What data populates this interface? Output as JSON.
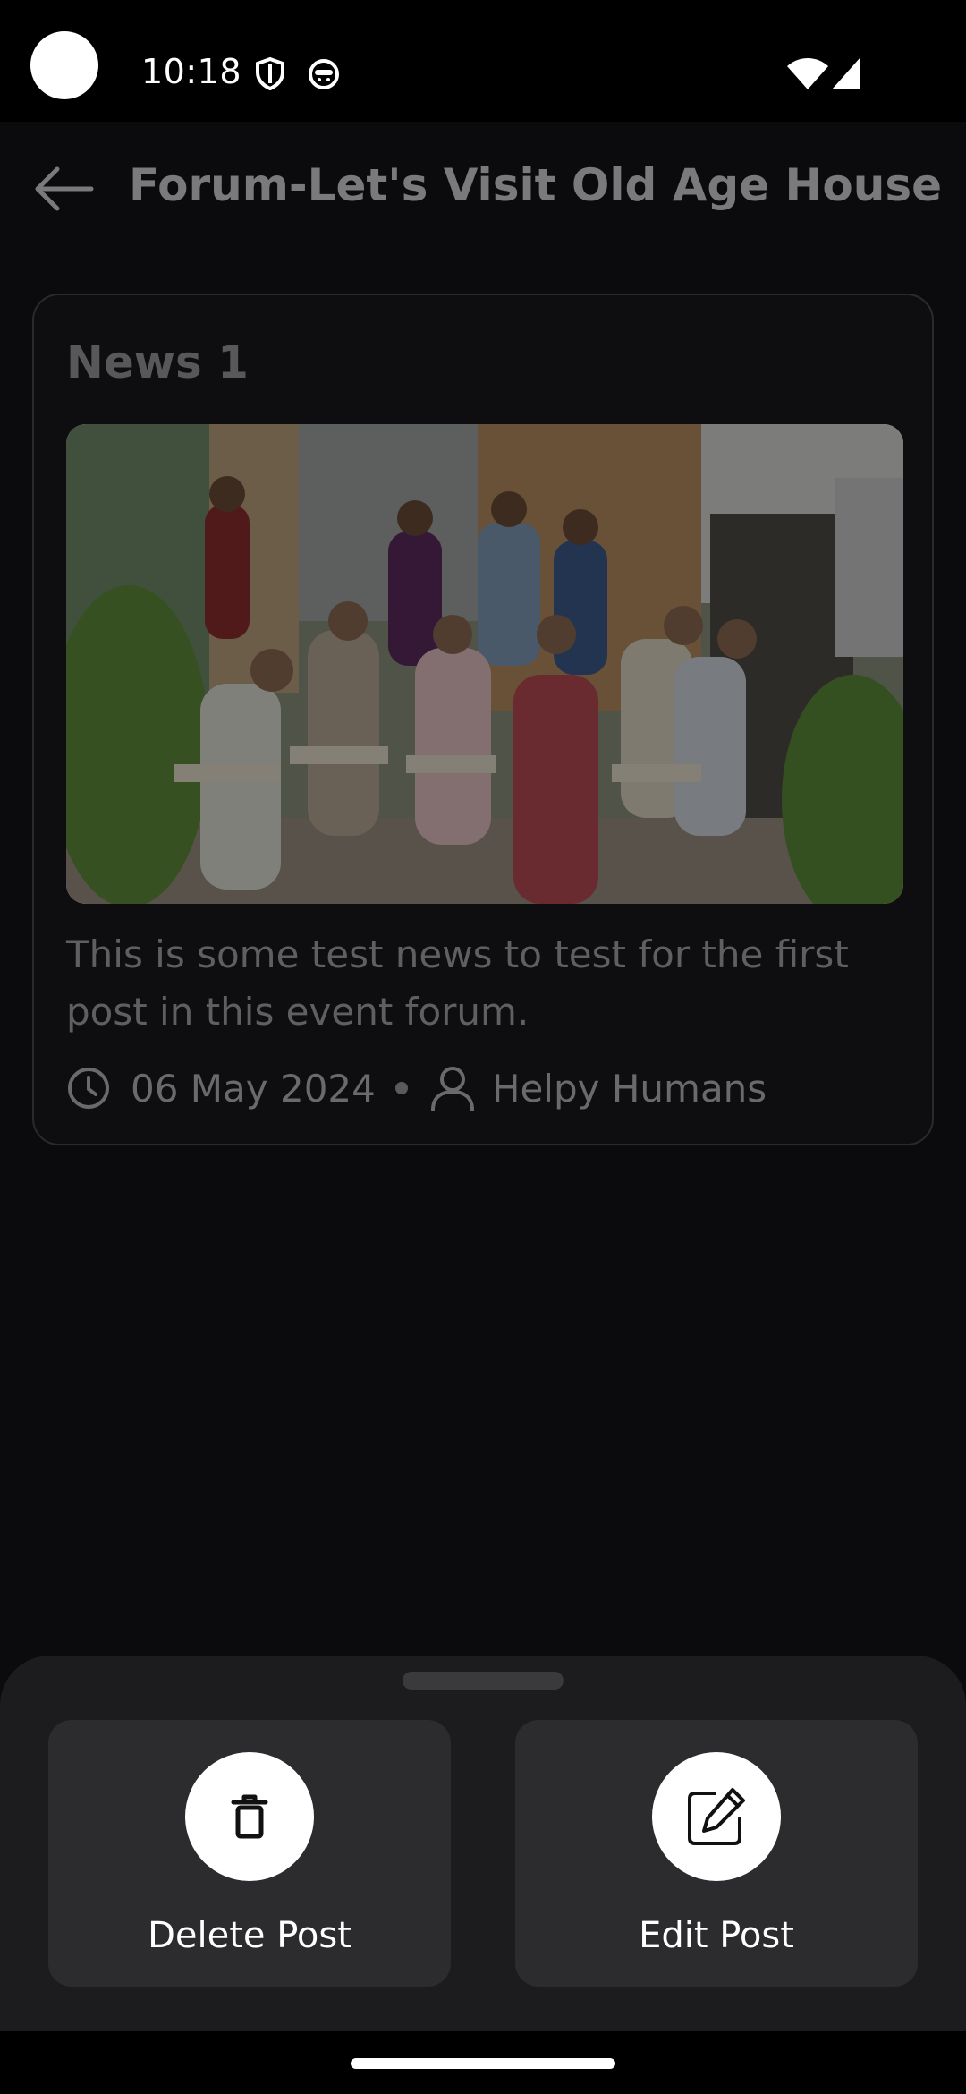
{
  "status_bar": {
    "time": "10:18",
    "icons": [
      "shield-icon",
      "cat-face-icon",
      "wifi-icon",
      "signal-icon"
    ]
  },
  "app_bar": {
    "back_icon": "arrow-left-icon",
    "title": "Forum-Let's Visit Old Age House"
  },
  "post": {
    "title": "News 1",
    "image_alt": "group photo",
    "body": "This is some test news to test for the first post in this event forum.",
    "date": "06 May 2024",
    "author": "Helpy Humans"
  },
  "sheet": {
    "delete_label": "Delete Post",
    "edit_label": "Edit Post",
    "delete_icon": "trash-icon",
    "edit_icon": "edit-icon"
  },
  "colors": {
    "background": "#0b0b0d",
    "sheet": "#1c1c1f",
    "button": "#2c2c2f"
  }
}
